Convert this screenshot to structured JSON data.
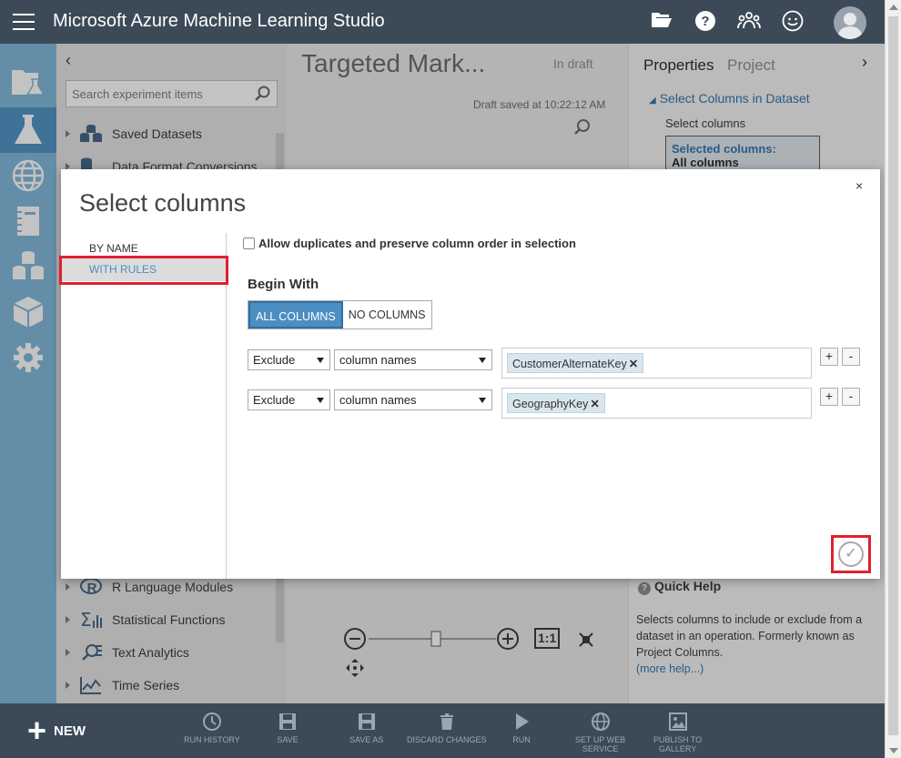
{
  "app": {
    "title": "Microsoft Azure Machine Learning Studio"
  },
  "palette": {
    "search_placeholder": "Search experiment items",
    "items_top": [
      "Saved Datasets",
      "Data Format Conversions"
    ],
    "items_bottom": [
      "R Language Modules",
      "Statistical Functions",
      "Text Analytics",
      "Time Series"
    ]
  },
  "canvas": {
    "experiment_title": "Targeted Mark...",
    "status": "In draft",
    "saved_text": "Draft saved at 10:22:12 AM",
    "zoom_fit_label": "1:1"
  },
  "properties": {
    "tab_properties": "Properties",
    "tab_project": "Project",
    "section_title": "Select Columns in Dataset",
    "select_columns_label": "Select columns",
    "selected_columns_title": "Selected columns:",
    "selected_columns_value": "All columns",
    "quick_help_title": "Quick Help",
    "quick_help_text": "Selects columns to include or exclude from a dataset in an operation. Formerly known as Project Columns.",
    "more_help": "(more help...)"
  },
  "modal": {
    "title": "Select columns",
    "close": "×",
    "nav": {
      "by_name": "BY NAME",
      "with_rules": "WITH RULES"
    },
    "allow_duplicates_label": "Allow duplicates and preserve column order in selection",
    "begin_with_label": "Begin With",
    "all_columns_label": "ALL COLUMNS",
    "no_columns_label": "NO COLUMNS",
    "rules": [
      {
        "action": "Exclude",
        "by": "column names",
        "tag": "CustomerAlternateKey"
      },
      {
        "action": "Exclude",
        "by": "column names",
        "tag": "GeographyKey"
      }
    ],
    "plus": "+",
    "minus": "-",
    "ok": "✓"
  },
  "bottombar": {
    "new_label": "NEW",
    "run_history": "RUN HISTORY",
    "save": "SAVE",
    "save_as": "SAVE AS",
    "discard_changes": "DISCARD CHANGES",
    "run": "RUN",
    "set_up_web_service_1": "SET UP WEB",
    "set_up_web_service_2": "SERVICE",
    "publish_to_gallery_1": "PUBLISH TO",
    "publish_to_gallery_2": "GALLERY"
  },
  "colors": {
    "topbar": "#3c4a58",
    "rail": "#7cb4d8",
    "accent": "#4a8ec2",
    "highlight_box": "#e02030"
  }
}
